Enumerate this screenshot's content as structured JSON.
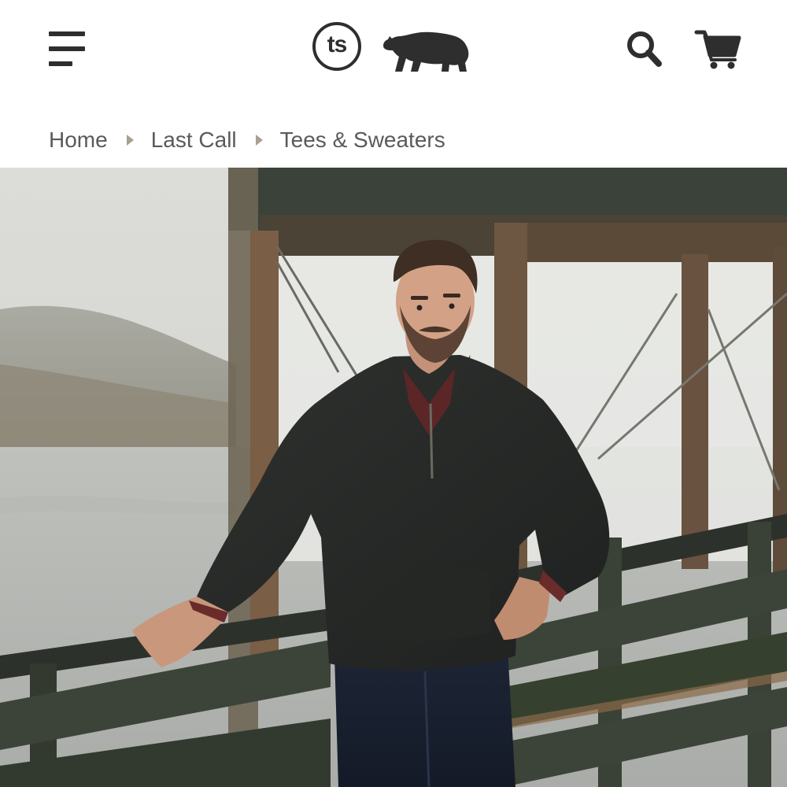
{
  "header": {
    "menu_icon": "hamburger-menu-icon",
    "logo_monogram": "ts",
    "logo_mark": "bear-icon",
    "search_icon": "search-icon",
    "cart_icon": "cart-icon",
    "icon_color": "#2e2e2e"
  },
  "breadcrumb": {
    "items": [
      {
        "label": "Home"
      },
      {
        "label": "Last Call"
      },
      {
        "label": "Tees & Sweaters"
      }
    ],
    "separator_icon": "triangle-right-icon",
    "separator_color": "#a8a090",
    "text_color": "#5a5a5a"
  },
  "hero": {
    "subject": "product-photo"
  }
}
